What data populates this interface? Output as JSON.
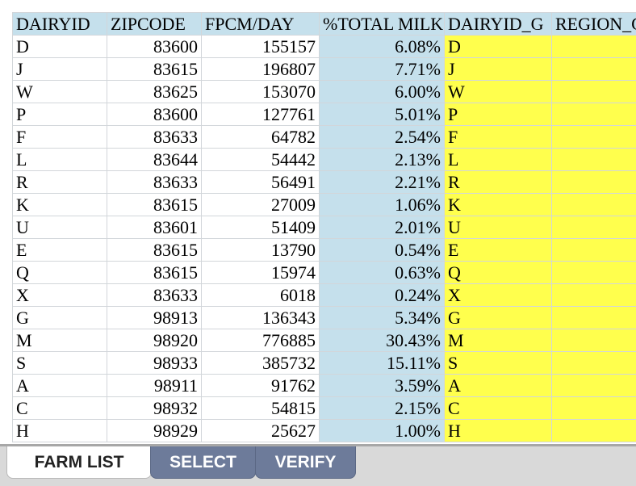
{
  "columns": [
    "DAIRYID",
    "ZIPCODE",
    "FPCM/DAY",
    "%TOTAL MILK",
    "DAIRYID_G",
    "REGION_G"
  ],
  "rows": [
    {
      "id": "D",
      "zip": "83600",
      "fpcm": "155157",
      "pct": "6.08%",
      "gid": "D"
    },
    {
      "id": "J",
      "zip": "83615",
      "fpcm": "196807",
      "pct": "7.71%",
      "gid": "J"
    },
    {
      "id": "W",
      "zip": "83625",
      "fpcm": "153070",
      "pct": "6.00%",
      "gid": "W"
    },
    {
      "id": "P",
      "zip": "83600",
      "fpcm": "127761",
      "pct": "5.01%",
      "gid": "P"
    },
    {
      "id": "F",
      "zip": "83633",
      "fpcm": "64782",
      "pct": "2.54%",
      "gid": "F"
    },
    {
      "id": "L",
      "zip": "83644",
      "fpcm": "54442",
      "pct": "2.13%",
      "gid": "L"
    },
    {
      "id": "R",
      "zip": "83633",
      "fpcm": "56491",
      "pct": "2.21%",
      "gid": "R"
    },
    {
      "id": "K",
      "zip": "83615",
      "fpcm": "27009",
      "pct": "1.06%",
      "gid": "K"
    },
    {
      "id": "U",
      "zip": "83601",
      "fpcm": "51409",
      "pct": "2.01%",
      "gid": "U"
    },
    {
      "id": "E",
      "zip": "83615",
      "fpcm": "13790",
      "pct": "0.54%",
      "gid": "E"
    },
    {
      "id": "Q",
      "zip": "83615",
      "fpcm": "15974",
      "pct": "0.63%",
      "gid": "Q"
    },
    {
      "id": "X",
      "zip": "83633",
      "fpcm": "6018",
      "pct": "0.24%",
      "gid": "X"
    },
    {
      "id": "G",
      "zip": "98913",
      "fpcm": "136343",
      "pct": "5.34%",
      "gid": "G"
    },
    {
      "id": "M",
      "zip": "98920",
      "fpcm": "776885",
      "pct": "30.43%",
      "gid": "M"
    },
    {
      "id": "S",
      "zip": "98933",
      "fpcm": "385732",
      "pct": "15.11%",
      "gid": "S"
    },
    {
      "id": "A",
      "zip": "98911",
      "fpcm": "91762",
      "pct": "3.59%",
      "gid": "A"
    },
    {
      "id": "C",
      "zip": "98932",
      "fpcm": "54815",
      "pct": "2.15%",
      "gid": "C"
    },
    {
      "id": "H",
      "zip": "98929",
      "fpcm": "25627",
      "pct": "1.00%",
      "gid": "H"
    }
  ],
  "tabs": {
    "farm_list": "FARM LIST",
    "select": "SELECT",
    "verify": "VERIFY"
  },
  "colors": {
    "header_bg": "#c5e0ec",
    "pct_bg": "#c5e0ec",
    "highlight_yellow": "#ffff4d",
    "tab_inactive": "#6d7b9a",
    "tab_bar": "#d9d9d9"
  }
}
